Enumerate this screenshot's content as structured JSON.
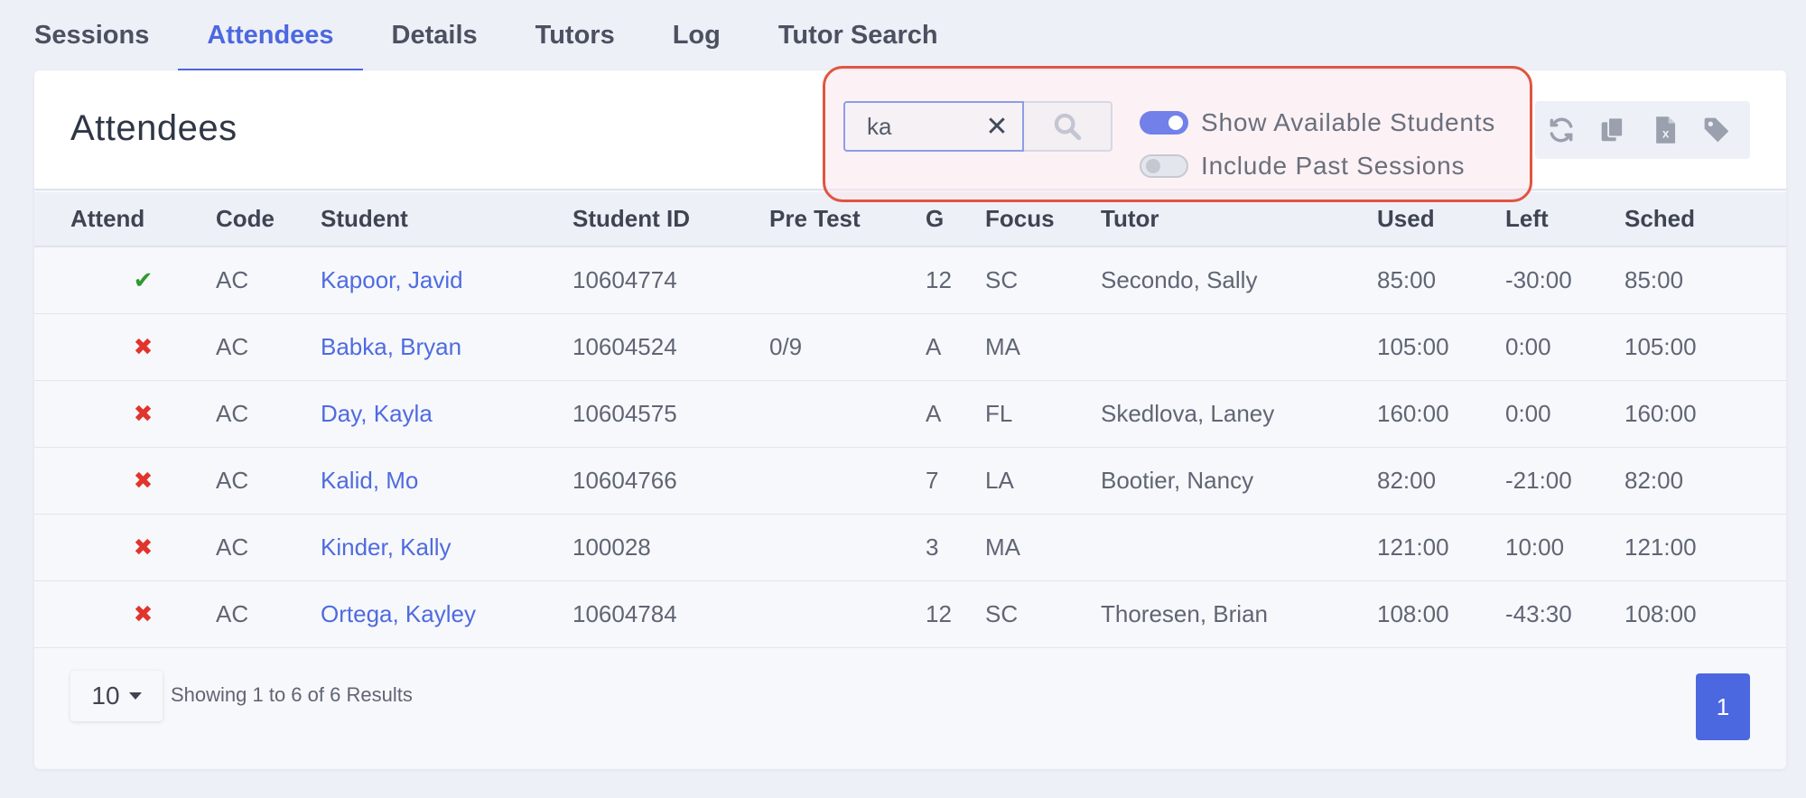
{
  "tabs": [
    "Sessions",
    "Attendees",
    "Details",
    "Tutors",
    "Log",
    "Tutor Search"
  ],
  "active_tab": "Attendees",
  "card": {
    "title": "Attendees"
  },
  "search": {
    "value": "ka",
    "clear_icon": "close-icon",
    "button_icon": "search-icon"
  },
  "toggles": {
    "show_available": {
      "label": "Show Available Students",
      "on": true
    },
    "include_past": {
      "label": "Include Past Sessions",
      "on": false
    }
  },
  "toolbar_icons": [
    "refresh-icon",
    "copy-icon",
    "excel-icon",
    "tag-icon"
  ],
  "table": {
    "headers": [
      "Attend",
      "Code",
      "Student",
      "Student ID",
      "Pre Test",
      "G",
      "Focus",
      "Tutor",
      "Used",
      "Left",
      "Sched"
    ],
    "rows": [
      {
        "attend": "✔",
        "attended": true,
        "code": "AC",
        "student": "Kapoor, Javid",
        "student_id": "10604774",
        "pre_test": "",
        "g": "12",
        "focus": "SC",
        "tutor": "Secondo, Sally",
        "used": "85:00",
        "left": "-30:00",
        "sched": "85:00"
      },
      {
        "attend": "✖",
        "attended": false,
        "code": "AC",
        "student": "Babka, Bryan",
        "student_id": "10604524",
        "pre_test": "0/9",
        "g": "A",
        "focus": "MA",
        "tutor": "",
        "used": "105:00",
        "left": "0:00",
        "sched": "105:00"
      },
      {
        "attend": "✖",
        "attended": false,
        "code": "AC",
        "student": "Day, Kayla",
        "student_id": "10604575",
        "pre_test": "",
        "g": "A",
        "focus": "FL",
        "tutor": "Skedlova, Laney",
        "used": "160:00",
        "left": "0:00",
        "sched": "160:00"
      },
      {
        "attend": "✖",
        "attended": false,
        "code": "AC",
        "student": "Kalid, Mo",
        "student_id": "10604766",
        "pre_test": "",
        "g": "7",
        "focus": "LA",
        "tutor": "Bootier, Nancy",
        "used": "82:00",
        "left": "-21:00",
        "sched": "82:00"
      },
      {
        "attend": "✖",
        "attended": false,
        "code": "AC",
        "student": "Kinder, Kally",
        "student_id": "100028",
        "pre_test": "",
        "g": "3",
        "focus": "MA",
        "tutor": "",
        "used": "121:00",
        "left": "10:00",
        "sched": "121:00"
      },
      {
        "attend": "✖",
        "attended": false,
        "code": "AC",
        "student": "Ortega, Kayley",
        "student_id": "10604784",
        "pre_test": "",
        "g": "12",
        "focus": "SC",
        "tutor": "Thoresen, Brian",
        "used": "108:00",
        "left": "-43:30",
        "sched": "108:00"
      }
    ]
  },
  "footer": {
    "page_size": "10",
    "results_text": "Showing 1 to 6 of 6 Results",
    "current_page": "1"
  },
  "colors": {
    "accent": "#4c68e0",
    "attend_yes": "#2e9a2e",
    "attend_no": "#e2342c",
    "highlight": "#e0553f"
  }
}
